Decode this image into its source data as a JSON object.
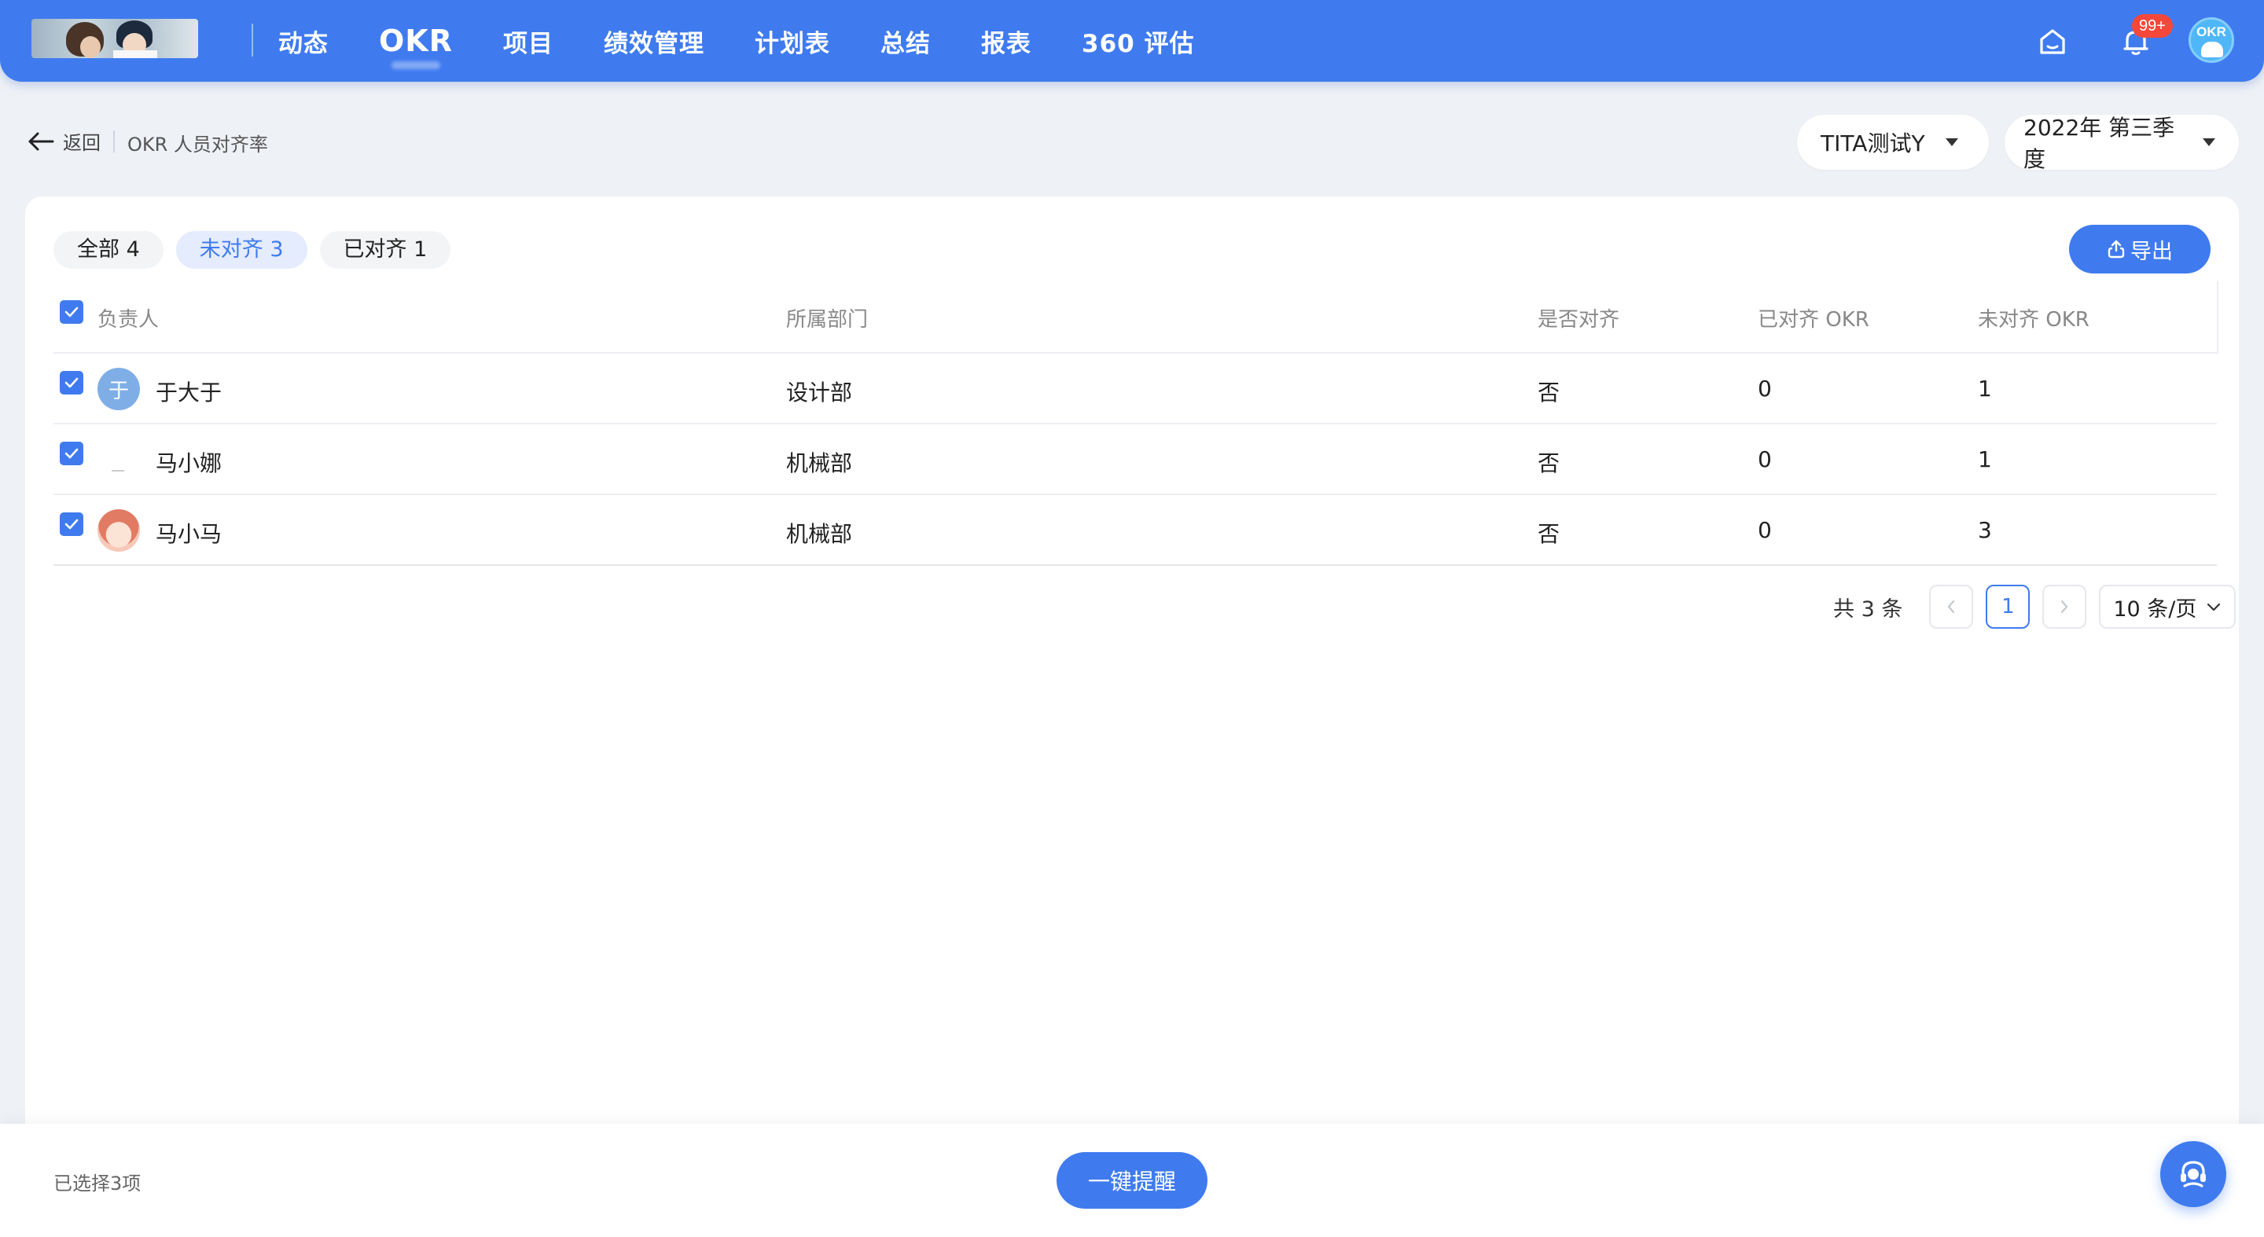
{
  "nav": {
    "items": [
      {
        "label": "动态",
        "active": false
      },
      {
        "label": "OKR",
        "active": true
      },
      {
        "label": "项目",
        "active": false
      },
      {
        "label": "绩效管理",
        "active": false
      },
      {
        "label": "计划表",
        "active": false
      },
      {
        "label": "总结",
        "active": false
      },
      {
        "label": "报表",
        "active": false
      },
      {
        "label": "360 评估",
        "active": false
      }
    ],
    "notification_badge": "99+",
    "user_avatar_text": "OKR",
    "icons": [
      "home-icon",
      "bell-icon"
    ]
  },
  "header": {
    "back_label": "返回",
    "breadcrumb": "OKR 人员对齐率",
    "org_select": "TITA测试Y",
    "period_select": "2022年 第三季度"
  },
  "tabs": [
    {
      "label": "全部 4",
      "active": false
    },
    {
      "label": "未对齐 3",
      "active": true
    },
    {
      "label": "已对齐 1",
      "active": false
    }
  ],
  "export_label": "导出",
  "table": {
    "columns": [
      "负责人",
      "所属部门",
      "是否对齐",
      "已对齐 OKR",
      "未对齐 OKR"
    ],
    "rows": [
      {
        "avatar_text": "于",
        "name": "于大于",
        "dept": "设计部",
        "aligned": "否",
        "aligned_okr": "0",
        "unaligned_okr": "1"
      },
      {
        "avatar_text": "",
        "name": "马小娜",
        "dept": "机械部",
        "aligned": "否",
        "aligned_okr": "0",
        "unaligned_okr": "1"
      },
      {
        "avatar_text": "",
        "name": "马小马",
        "dept": "机械部",
        "aligned": "否",
        "aligned_okr": "0",
        "unaligned_okr": "3"
      }
    ]
  },
  "pagination": {
    "total": "共 3 条",
    "current_page": "1",
    "page_size": "10 条/页"
  },
  "footer": {
    "selected": "已选择3项",
    "remind_label": "一键提醒"
  },
  "colors": {
    "primary": "#3f7bef",
    "background": "#eef1f6",
    "badge": "#f5483b"
  }
}
